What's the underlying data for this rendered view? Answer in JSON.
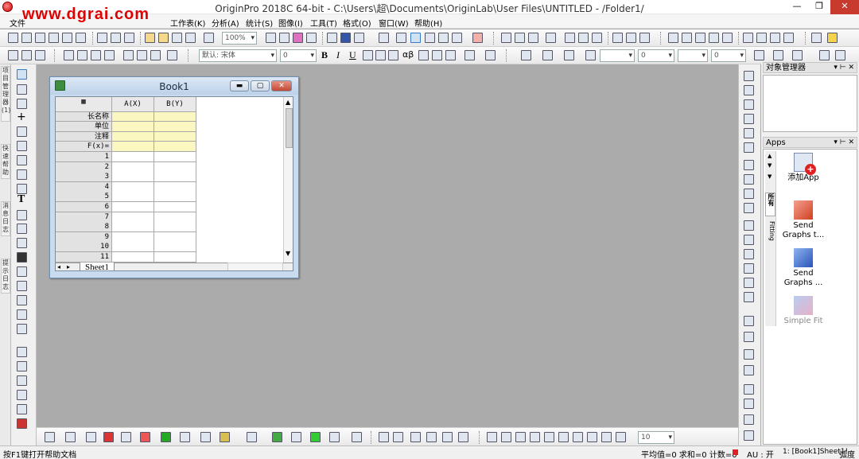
{
  "window": {
    "title": "OriginPro 2018C 64-bit - C:\\Users\\超\\Documents\\OriginLab\\User Files\\UNTITLED - /Folder1/",
    "watermark": "www.dgrai.com",
    "min": "—",
    "max": "❐",
    "close": "✕"
  },
  "menu": [
    "文件",
    "工作表(K)",
    "分析(A)",
    "统计(S)",
    "图像(I)",
    "工具(T)",
    "格式(O)",
    "窗口(W)",
    "帮助(H)"
  ],
  "toolbar1": {
    "zoom": "100%"
  },
  "toolbar2": {
    "font": "默认: 宋体",
    "font_size": "0",
    "line_width": "0",
    "fill": "0",
    "bold": "B",
    "italic": "I",
    "underline": "U",
    "greek": "αβ"
  },
  "left_tabs": [
    "项目管理器 (1)",
    "快速帮助",
    "消息日志",
    "提示日志"
  ],
  "workbook": {
    "title": "Book1",
    "columns": [
      "A(X)",
      "B(Y)"
    ],
    "meta_rows": [
      "长名称",
      "单位",
      "注释",
      "F(x)="
    ],
    "rows": [
      "1",
      "2",
      "3",
      "4",
      "5",
      "6",
      "7",
      "8",
      "9",
      "10",
      "11"
    ],
    "sheet": "Sheet1"
  },
  "object_manager": {
    "title": "对象管理器"
  },
  "apps_panel": {
    "title": "Apps",
    "vertical_tabs": [
      "所有",
      "Fitting"
    ],
    "items": [
      {
        "label": "添加App",
        "icon": "add-app-icon"
      },
      {
        "label": "Send\nGraphs t...",
        "icon": "send-to-powerpoint-icon"
      },
      {
        "label": "Send\nGraphs ...",
        "icon": "send-to-word-icon"
      },
      {
        "label": "Simple Fit",
        "icon": "simple-fit-icon"
      }
    ]
  },
  "bottom_toolbar": {
    "size_combo": "10"
  },
  "status": {
    "help": "按F1键打开帮助文档",
    "stats": "平均值=0 求和=0 计数=0",
    "au": "AU : 开",
    "sheet": "1: [Book1]Sheet1!",
    "angle": "弧度"
  },
  "colors": {
    "accent": "#c73a2d",
    "header_yellow": "#faf7c0",
    "workspace": "#ababab"
  }
}
